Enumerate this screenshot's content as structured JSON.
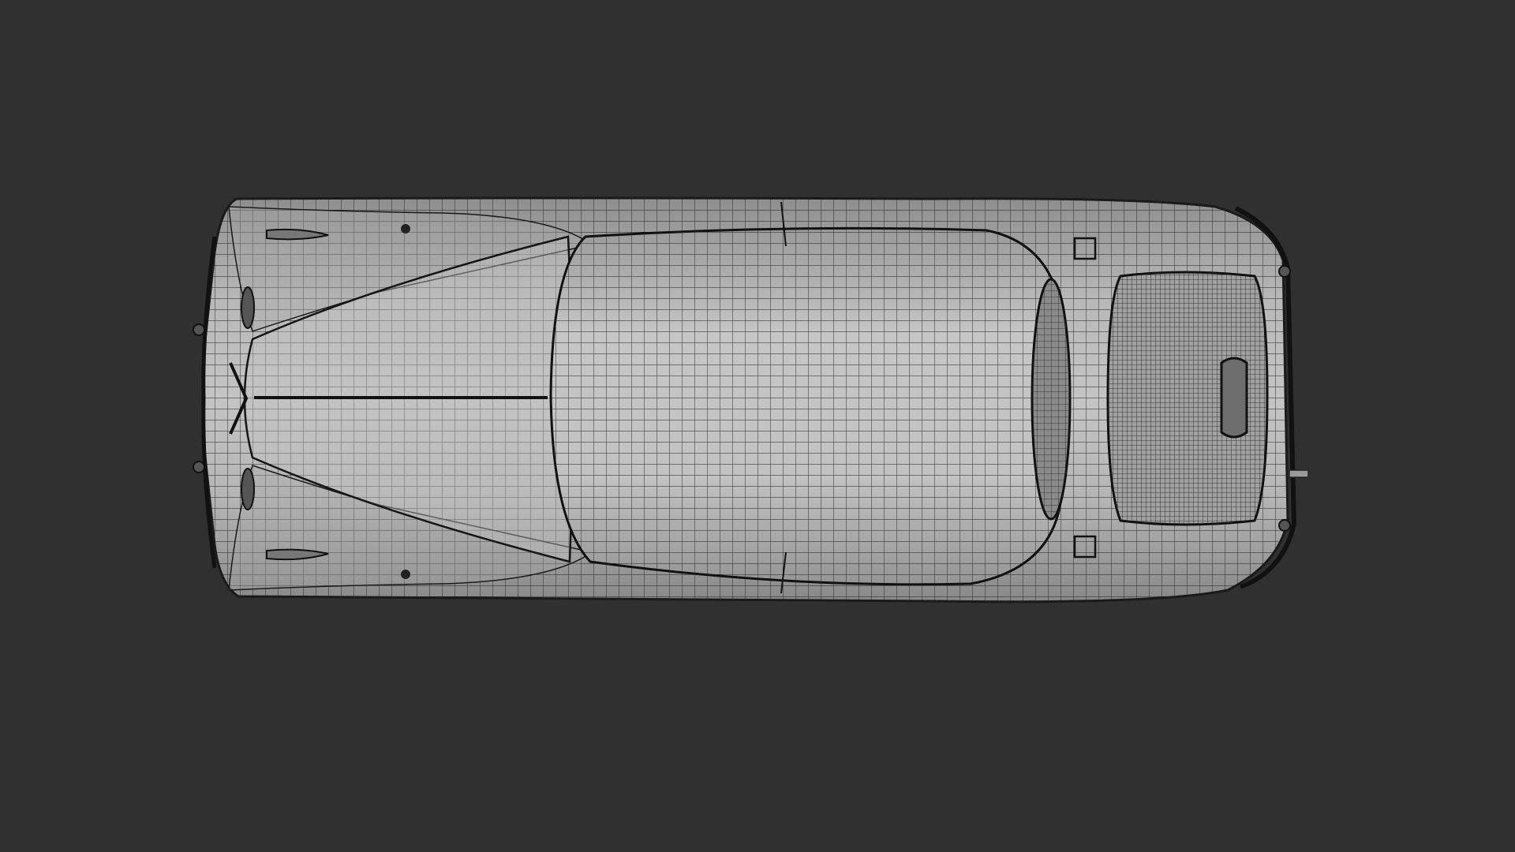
{
  "viewport": {
    "view": "top",
    "shading": "solid",
    "overlay": "wireframe",
    "background_color": "#303030",
    "object": {
      "name": "",
      "color": "#bfbfbf",
      "wire_color": "#1a1a1a"
    }
  }
}
